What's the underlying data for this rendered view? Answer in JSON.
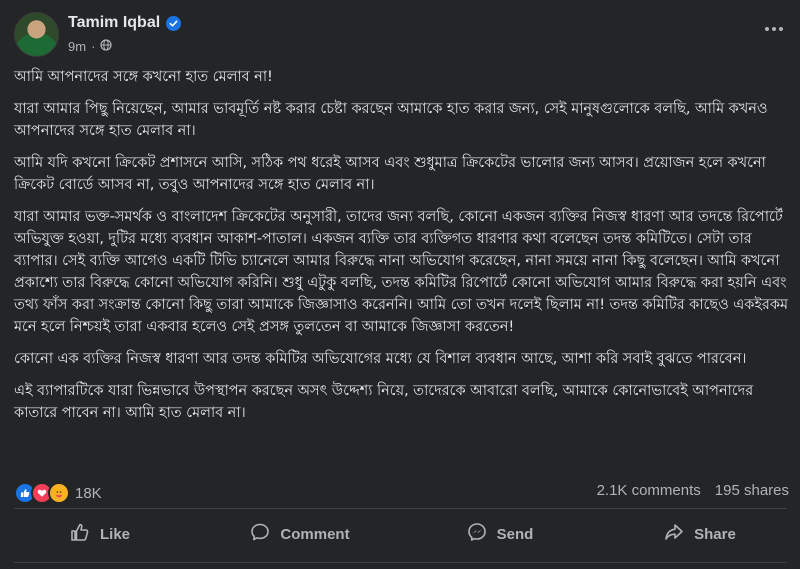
{
  "post": {
    "author": "Tamim Iqbal",
    "time": "9m",
    "separator": "·",
    "verified_icon": "verified-badge-icon",
    "paragraphs": [
      "আমি আপনাদের সঙ্গে কখনো হাত মেলাব না!",
      "যারা আমার পিছু নিয়েছেন, আমার ভাবমূর্তি নষ্ট করার চেষ্টা করছেন আমাকে হাত করার জন্য, সেই মানুষগুলোকে বলছি, আমি কখনও আপনাদের সঙ্গে হাত মেলাব না।",
      "আমি যদি কখনো ক্রিকেট প্রশাসনে আসি, সঠিক পথ ধরেই আসব এবং শুধুমাত্র ক্রিকেটের ভালোর জন্য আসব। প্রয়োজন হলে কখনো ক্রিকেট বোর্ডে আসব না, তবুও আপনাদের সঙ্গে হাত মেলাব না।",
      "যারা আমার ভক্ত-সমর্থক ও বাংলাদেশ ক্রিকেটের অনুসারী, তাদের জন্য বলছি, কোনো একজন ব্যক্তির নিজস্ব ধারণা আর তদন্তে রিপোর্টে অভিযুক্ত হওয়া, দুটির মধ্যে ব্যবধান আকাশ-পাতাল। একজন ব্যক্তি তার ব্যক্তিগত ধারণার কথা বলেছেন তদন্ত কমিটিতে। সেটা তার ব্যাপার। সেই ব্যক্তি আগেও একটি টিভি চ্যানেলে আমার বিরুদ্ধে নানা অভিযোগ করেছেন, নানা সময়ে নানা কিছু বলেছেন। আমি কখনো প্রকাশ্যে তার বিরুদ্ধে কোনো অভিযোগ করিনি। শুধু এটুকু বলছি, তদন্ত কমিটির রিপোর্টে কোনো অভিযোগ আমার বিরুদ্ধে করা হয়নি এবং তথ্য ফাঁস করা সংক্রান্ত কোনো কিছু তারা আমাকে জিজ্ঞাসাও করেননি। আমি তো তখন দলেই ছিলাম না! তদন্ত কমিটির কাছেও একইরকম মনে হলে নিশ্চয়ই তারা একবার হলেও সেই প্রসঙ্গ তুলতেন বা আমাকে জিজ্ঞাসা করতেন!",
      "কোনো এক ব্যক্তির নিজস্ব ধারণা আর তদন্ত কমিটির অভিযোগের মধ্যে যে বিশাল ব্যবধান আছে, আশা করি সবাই বুঝতে পারবেন।",
      "এই ব্যাপারটিকে যারা ভিন্নভাবে উপস্থাপন করছেন অসৎ উদ্দেশ্য নিয়ে, তাদেরকে আবারো বলছি, আমাকে কোনোভাবেই আপনাদের কাতারে পাবেন না। আমি হাত মেলাব না।"
    ]
  },
  "stats": {
    "reaction_count": "18K",
    "comments": "2.1K comments",
    "shares": "195 shares",
    "reaction_icons": [
      "like-icon",
      "love-icon",
      "care-icon"
    ]
  },
  "actions": {
    "like": "Like",
    "comment": "Comment",
    "send": "Send",
    "share": "Share"
  },
  "colors": {
    "background": "#242526",
    "text": "#e4e6eb",
    "secondary": "#b0b3b8",
    "accent": "#1b74e4"
  }
}
